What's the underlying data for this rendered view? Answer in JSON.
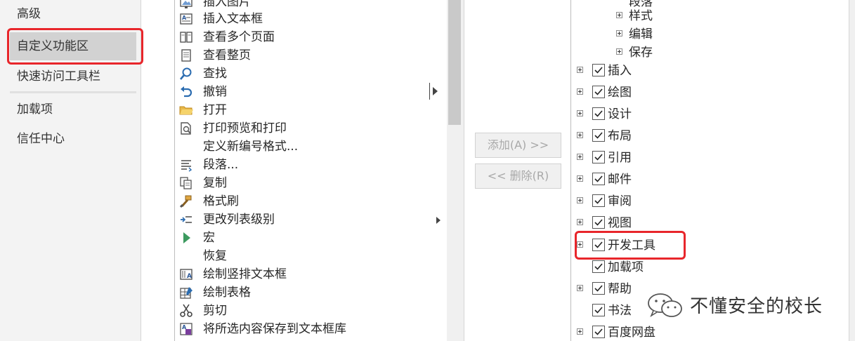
{
  "nav": {
    "items": [
      {
        "label": "高级",
        "selected": false
      },
      {
        "label": "自定义功能区",
        "selected": true
      },
      {
        "label": "快速访问工具栏",
        "selected": false
      },
      {
        "label": "加载项",
        "selected": false
      },
      {
        "label": "信任中心",
        "selected": false
      }
    ]
  },
  "commands": [
    {
      "label": "插入图片",
      "icon": "picture-icon",
      "submenu": false
    },
    {
      "label": "插入文本框",
      "icon": "textbox-icon",
      "submenu": false
    },
    {
      "label": "查看多个页面",
      "icon": "multi-page-icon",
      "submenu": false
    },
    {
      "label": "查看整页",
      "icon": "one-page-icon",
      "submenu": false
    },
    {
      "label": "查找",
      "icon": "find-icon",
      "submenu": false
    },
    {
      "label": "撤销",
      "icon": "undo-icon",
      "submenu": true
    },
    {
      "label": "打开",
      "icon": "folder-icon",
      "submenu": false
    },
    {
      "label": "打印预览和打印",
      "icon": "print-preview-icon",
      "submenu": false
    },
    {
      "label": "定义新编号格式...",
      "icon": "",
      "submenu": false
    },
    {
      "label": "段落...",
      "icon": "paragraph-icon",
      "submenu": false
    },
    {
      "label": "复制",
      "icon": "copy-icon",
      "submenu": false
    },
    {
      "label": "格式刷",
      "icon": "format-painter-icon",
      "submenu": false
    },
    {
      "label": "更改列表级别",
      "icon": "list-level-icon",
      "submenu": true
    },
    {
      "label": "宏",
      "icon": "macro-play-icon",
      "submenu": false
    },
    {
      "label": "恢复",
      "icon": "",
      "submenu": false
    },
    {
      "label": "绘制竖排文本框",
      "icon": "vertical-textbox-icon",
      "submenu": false
    },
    {
      "label": "绘制表格",
      "icon": "draw-table-icon",
      "submenu": false
    },
    {
      "label": "剪切",
      "icon": "scissors-icon",
      "submenu": false
    },
    {
      "label": "将所选内容保存到文本框库",
      "icon": "save-selection-icon",
      "submenu": false
    }
  ],
  "buttons": {
    "add": "添加(A) >>",
    "remove": "<< 删除(R)"
  },
  "tree": [
    {
      "label": "段落",
      "level": 2,
      "checkbox": false,
      "expandable": false
    },
    {
      "label": "样式",
      "level": 2,
      "checkbox": false,
      "expandable": true
    },
    {
      "label": "编辑",
      "level": 2,
      "checkbox": false,
      "expandable": true
    },
    {
      "label": "保存",
      "level": 2,
      "checkbox": false,
      "expandable": true
    },
    {
      "label": "插入",
      "level": 1,
      "checkbox": true,
      "checked": true,
      "expandable": true
    },
    {
      "label": "绘图",
      "level": 1,
      "checkbox": true,
      "checked": true,
      "expandable": true
    },
    {
      "label": "设计",
      "level": 1,
      "checkbox": true,
      "checked": true,
      "expandable": true
    },
    {
      "label": "布局",
      "level": 1,
      "checkbox": true,
      "checked": true,
      "expandable": true
    },
    {
      "label": "引用",
      "level": 1,
      "checkbox": true,
      "checked": true,
      "expandable": true
    },
    {
      "label": "邮件",
      "level": 1,
      "checkbox": true,
      "checked": true,
      "expandable": true
    },
    {
      "label": "审阅",
      "level": 1,
      "checkbox": true,
      "checked": true,
      "expandable": true
    },
    {
      "label": "视图",
      "level": 1,
      "checkbox": true,
      "checked": true,
      "expandable": true
    },
    {
      "label": "开发工具",
      "level": 1,
      "checkbox": true,
      "checked": true,
      "expandable": true
    },
    {
      "label": "加载项",
      "level": 1,
      "checkbox": true,
      "checked": true,
      "expandable": false
    },
    {
      "label": "帮助",
      "level": 1,
      "checkbox": true,
      "checked": true,
      "expandable": true
    },
    {
      "label": "书法",
      "level": 1,
      "checkbox": true,
      "checked": true,
      "expandable": false
    },
    {
      "label": "百度网盘",
      "level": 1,
      "checkbox": true,
      "checked": true,
      "expandable": true
    }
  ],
  "watermark": {
    "text": "不懂安全的校长",
    "icon": "wechat-icon"
  },
  "colors": {
    "highlight": "#e8262b",
    "selected_nav": "#d2d2d2"
  }
}
